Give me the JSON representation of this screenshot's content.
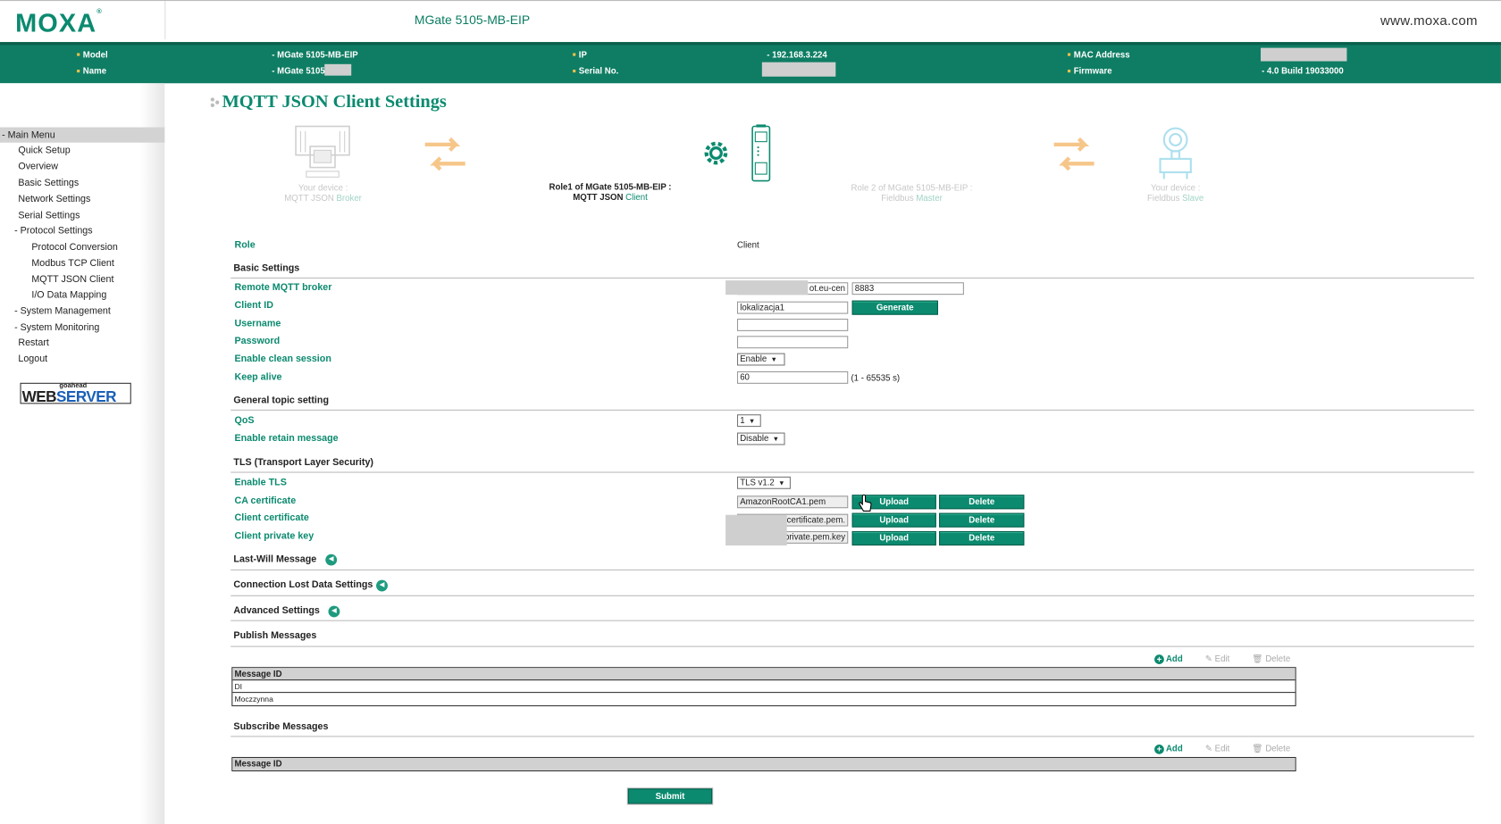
{
  "header": {
    "logo": "MOXA",
    "product_title": "MGate 5105-MB-EIP",
    "website": "www.moxa.com"
  },
  "info": {
    "model_label": "Model",
    "model_value": "MGate 5105-MB-EIP",
    "name_label": "Name",
    "name_value": "MGate 5105",
    "ip_label": "IP",
    "ip_value": "192.168.3.224",
    "serial_label": "Serial No.",
    "mac_label": "MAC Address",
    "firmware_label": "Firmware",
    "firmware_value": "4.0 Build 19033000"
  },
  "sidebar": {
    "head": "- Main Menu",
    "items": [
      {
        "label": "Quick Setup"
      },
      {
        "label": "Overview"
      },
      {
        "label": "Basic Settings"
      },
      {
        "label": "Network Settings"
      },
      {
        "label": "Serial Settings"
      },
      {
        "label": "- Protocol Settings"
      },
      {
        "label": "Protocol Conversion"
      },
      {
        "label": "Modbus TCP Client"
      },
      {
        "label": "MQTT JSON Client"
      },
      {
        "label": "I/O Data Mapping"
      },
      {
        "label": "- System Management"
      },
      {
        "label": "- System Monitoring"
      },
      {
        "label": "Restart"
      },
      {
        "label": "Logout"
      }
    ],
    "badge_small": "goahead",
    "badge_big_a": "WEB",
    "badge_big_b": "SERVER"
  },
  "page": {
    "title": "MQTT JSON Client Settings"
  },
  "diagram": {
    "left_line1": "Your device :",
    "left_line2a": "MQTT JSON ",
    "left_line2b": "Broker",
    "role1_line1": "Role1 of MGate 5105-MB-EIP :",
    "role1_line2a": "MQTT JSON ",
    "role1_line2b": "Client",
    "role2_line1": "Role 2 of MGate 5105-MB-EIP :",
    "role2_line2a": "Fieldbus ",
    "role2_line2b": "Master",
    "right_line1": "Your device :",
    "right_line2a": "Fieldbus ",
    "right_line2b": "Slave"
  },
  "form": {
    "role_label": "Role",
    "role_value": "Client",
    "basic_settings": "Basic Settings",
    "broker_label": "Remote MQTT broker",
    "broker_host": "ot.eu-cen",
    "broker_port": "8883",
    "client_id_label": "Client ID",
    "client_id_value": "lokalizacja1",
    "generate_label": "Generate",
    "username_label": "Username",
    "password_label": "Password",
    "clean_session_label": "Enable clean session",
    "clean_session_value": "Enable",
    "keep_alive_label": "Keep alive",
    "keep_alive_value": "60",
    "keep_alive_range": "(1 - 65535 s)",
    "general_topic": "General topic setting",
    "qos_label": "QoS",
    "qos_value": "1",
    "retain_label": "Enable retain message",
    "retain_value": "Disable",
    "tls_section": "TLS (Transport Layer Security)",
    "enable_tls_label": "Enable TLS",
    "enable_tls_value": "TLS v1.2",
    "ca_cert_label": "CA certificate",
    "ca_cert_value": "AmazonRootCA1.pem",
    "client_cert_label": "Client certificate",
    "client_cert_value": "-certificate.pem.",
    "client_key_label": "Client private key",
    "client_key_value": "-private.pem.key",
    "upload_label": "Upload",
    "delete_label": "Delete",
    "last_will": "Last-Will Message",
    "conn_lost": "Connection Lost Data Settings",
    "advanced": "Advanced Settings",
    "publish": "Publish Messages",
    "subscribe": "Subscribe Messages",
    "add_label": "Add",
    "edit_label": "Edit",
    "delete_action_label": "Delete",
    "table_header": "Message ID",
    "publish_rows": [
      "DI",
      "Moczzynna"
    ],
    "submit_label": "Submit"
  }
}
